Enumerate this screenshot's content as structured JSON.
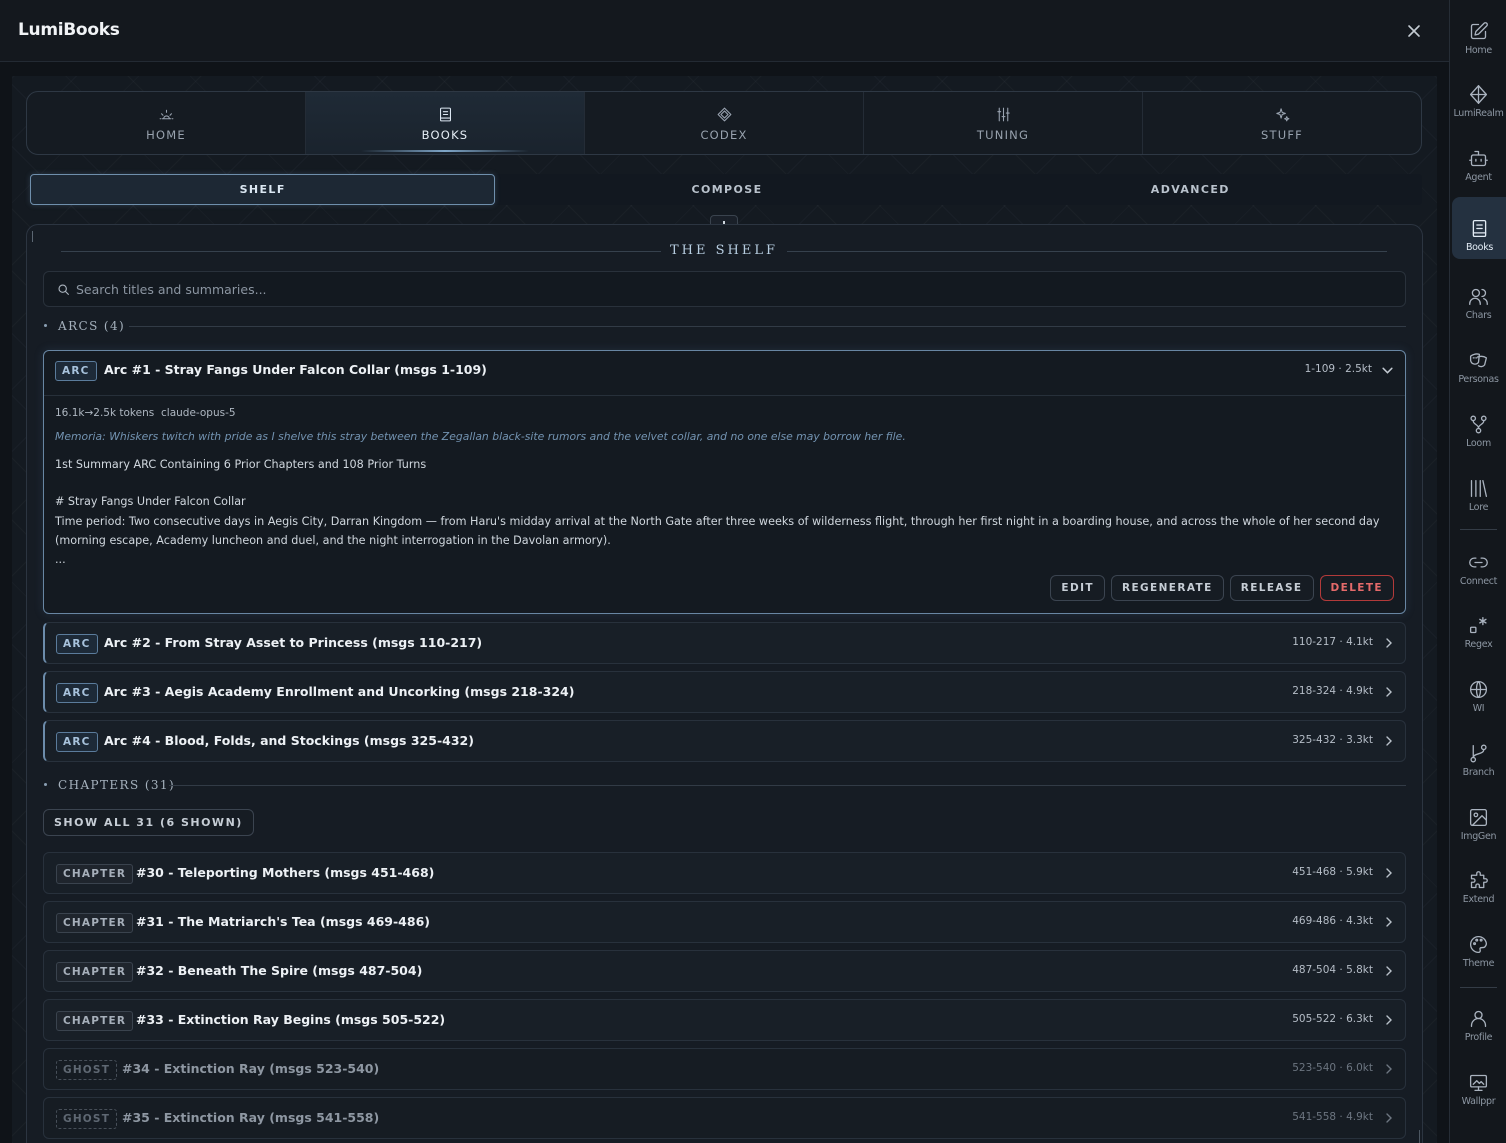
{
  "app": {
    "title": "LumiBooks"
  },
  "rail": {
    "items": [
      {
        "label": "Home",
        "icon": "edit-icon"
      },
      {
        "label": "LumiRealm",
        "icon": "diamond-icon"
      },
      {
        "label": "Agent",
        "icon": "bot-icon"
      },
      {
        "label": "Books",
        "icon": "book-icon",
        "active": true
      },
      {
        "label": "Chars",
        "icon": "users-icon"
      },
      {
        "label": "Personas",
        "icon": "mask-icon"
      },
      {
        "label": "Loom",
        "icon": "loom-icon"
      },
      {
        "label": "Lore",
        "icon": "library-icon"
      },
      {
        "label": "Connect",
        "icon": "link-icon"
      },
      {
        "label": "Regex",
        "icon": "regex-icon"
      },
      {
        "label": "WI",
        "icon": "globe-icon"
      },
      {
        "label": "Branch",
        "icon": "branch-icon"
      },
      {
        "label": "ImgGen",
        "icon": "image-icon"
      },
      {
        "label": "Extend",
        "icon": "puzzle-icon"
      },
      {
        "label": "Theme",
        "icon": "palette-icon"
      },
      {
        "label": "Profile",
        "icon": "user-icon"
      },
      {
        "label": "Wallppr",
        "icon": "wallpaper-icon"
      }
    ]
  },
  "tabs": [
    {
      "label": "HOME",
      "icon": "sun-icon"
    },
    {
      "label": "BOOKS",
      "icon": "book-icon",
      "active": true
    },
    {
      "label": "CODEX",
      "icon": "diamond-icon"
    },
    {
      "label": "TUNING",
      "icon": "sliders-icon"
    },
    {
      "label": "STUFF",
      "icon": "sparkles-icon"
    }
  ],
  "subtabs": [
    {
      "label": "SHELF",
      "active": true
    },
    {
      "label": "COMPOSE"
    },
    {
      "label": "ADVANCED"
    }
  ],
  "shelf": {
    "title": "THE SHELF",
    "search_placeholder": "Search titles and summaries...",
    "arcs_header": "ARCS (4)",
    "chapters_header": "CHAPTERS (31)",
    "show_all": "SHOW ALL 31 (6 SHOWN)",
    "arc_open": {
      "badge": "ARC",
      "name": "Arc #1 - Stray Fangs Under Falcon Collar (msgs 1-109)",
      "meta": "1-109 · 2.5kt",
      "tokens": "16.1k→2.5k tokens",
      "model": "claude-opus-5",
      "memoria": "Memoria: Whiskers twitch with pride as I shelve this stray between the Zegallan black-site rumors and the velvet collar, and no one else may borrow her file.",
      "line1": "1st Summary ARC Containing 6 Prior Chapters and 108 Prior Turns",
      "heading": "# Stray Fangs Under Falcon Collar",
      "period": "Time period: Two consecutive days in Aegis City, Darran Kingdom — from Haru's midday arrival at the North Gate after three weeks of wilderness flight, through her first night in a boarding house, and across the whole of her second day (morning escape, Academy luncheon and duel, and the night interrogation in the Davolan armory).",
      "ellipsis": "...",
      "actions": {
        "edit": "EDIT",
        "regenerate": "REGENERATE",
        "release": "RELEASE",
        "delete": "DELETE"
      }
    },
    "arcs": [
      {
        "badge": "ARC",
        "name": "Arc #2 - From Stray Asset to Princess (msgs 110-217)",
        "meta": "110-217 · 4.1kt"
      },
      {
        "badge": "ARC",
        "name": "Arc #3 - Aegis Academy Enrollment and Uncorking (msgs 218-324)",
        "meta": "218-324 · 4.9kt"
      },
      {
        "badge": "ARC",
        "name": "Arc #4 - Blood, Folds, and Stockings (msgs 325-432)",
        "meta": "325-432 · 3.3kt"
      }
    ],
    "chapters": [
      {
        "badge": "CHAPTER",
        "name": "#30 - Teleporting Mothers (msgs 451-468)",
        "meta": "451-468 · 5.9kt"
      },
      {
        "badge": "CHAPTER",
        "name": "#31 - The Matriarch's Tea (msgs 469-486)",
        "meta": "469-486 · 4.3kt"
      },
      {
        "badge": "CHAPTER",
        "name": "#32 - Beneath The Spire (msgs 487-504)",
        "meta": "487-504 · 5.8kt"
      },
      {
        "badge": "CHAPTER",
        "name": "#33 - Extinction Ray Begins (msgs 505-522)",
        "meta": "505-522 · 6.3kt"
      },
      {
        "badge": "GHOST",
        "name": "#34 - Extinction Ray (msgs 523-540)",
        "meta": "523-540 · 6.0kt"
      },
      {
        "badge": "GHOST",
        "name": "#35 - Extinction Ray (msgs 541-558)",
        "meta": "541-558 · 4.9kt"
      }
    ]
  }
}
